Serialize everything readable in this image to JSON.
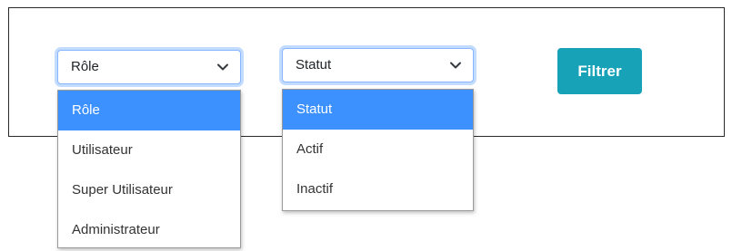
{
  "colors": {
    "focus_border": "#86b7fe",
    "selected_option": "#3d91ff",
    "filter_button": "#17a2b8",
    "panel_border": "#2a2a2a"
  },
  "role_select": {
    "value": "Rôle",
    "icon": "chevron-down-icon",
    "options": [
      "Rôle",
      "Utilisateur",
      "Super Utilisateur",
      "Administrateur"
    ],
    "selected_index": 0
  },
  "status_select": {
    "value": "Statut",
    "icon": "chevron-down-icon",
    "options": [
      "Statut",
      "Actif",
      "Inactif"
    ],
    "selected_index": 0
  },
  "filter_button": {
    "label": "Filtrer"
  }
}
